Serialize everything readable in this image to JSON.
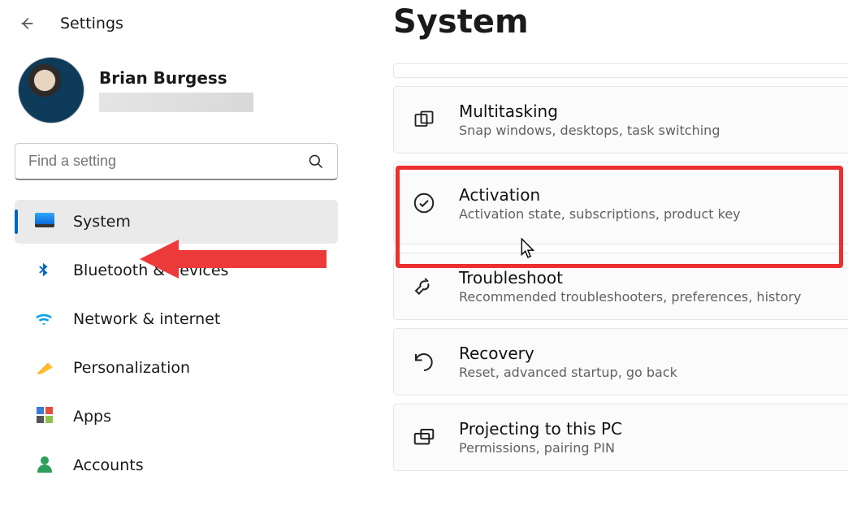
{
  "header": {
    "title": "Settings"
  },
  "user": {
    "name": "Brian Burgess"
  },
  "search": {
    "placeholder": "Find a setting"
  },
  "sidebar": {
    "items": [
      {
        "label": "System",
        "selected": true
      },
      {
        "label": "Bluetooth & devices"
      },
      {
        "label": "Network & internet"
      },
      {
        "label": "Personalization"
      },
      {
        "label": "Apps"
      },
      {
        "label": "Accounts"
      }
    ]
  },
  "main": {
    "title": "System",
    "cards": [
      {
        "title": "Multitasking",
        "sub": "Snap windows, desktops, task switching"
      },
      {
        "title": "Activation",
        "sub": "Activation state, subscriptions, product key",
        "highlighted": true
      },
      {
        "title": "Troubleshoot",
        "sub": "Recommended troubleshooters, preferences, history"
      },
      {
        "title": "Recovery",
        "sub": "Reset, advanced startup, go back"
      },
      {
        "title": "Projecting to this PC",
        "sub": "Permissions, pairing PIN"
      }
    ]
  },
  "annotation": {
    "arrow_color": "#ec3a3a"
  }
}
